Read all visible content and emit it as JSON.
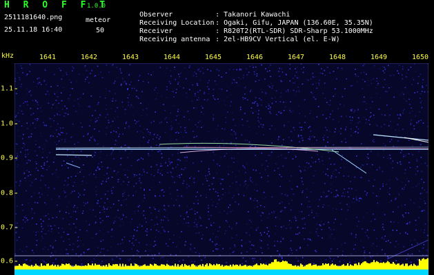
{
  "header": {
    "title": "H R O F F T",
    "version": "1.0.0",
    "filename": "2511181640.png",
    "timestamp": "25.11.18 16:40",
    "meteor_label": "meteor",
    "meteor_count": "50",
    "info": [
      {
        "key": "Observer",
        "sep": ":",
        "value": "Takanori Kawachi"
      },
      {
        "key": "Receiving Location",
        "sep": ":",
        "value": "Ogaki, Gifu, JAPAN (136.60E, 35.35N)"
      },
      {
        "key": "Receiver",
        "sep": ":",
        "value": "R820T2(RTL-SDR) SDR-Sharp 53.1000MHz"
      },
      {
        "key": "Receiving antenna",
        "sep": ":",
        "value": "2el-HB9CV Vertical (el. E-W)"
      }
    ]
  },
  "plot": {
    "y_unit": "kHz",
    "x_ticks": [
      "1641",
      "1642",
      "1643",
      "1644",
      "1645",
      "1646",
      "1647",
      "1648",
      "1649",
      "1650"
    ],
    "y_ticks": [
      "1.1",
      "1.0",
      "0.9",
      "0.8",
      "0.7",
      "0.6"
    ],
    "colors": {
      "tick": "#ffff4a",
      "noise": "#1a1aa8",
      "carrier": "#b8e0ff",
      "level": "#ffff00",
      "baseline": "#00d8ff"
    }
  }
}
